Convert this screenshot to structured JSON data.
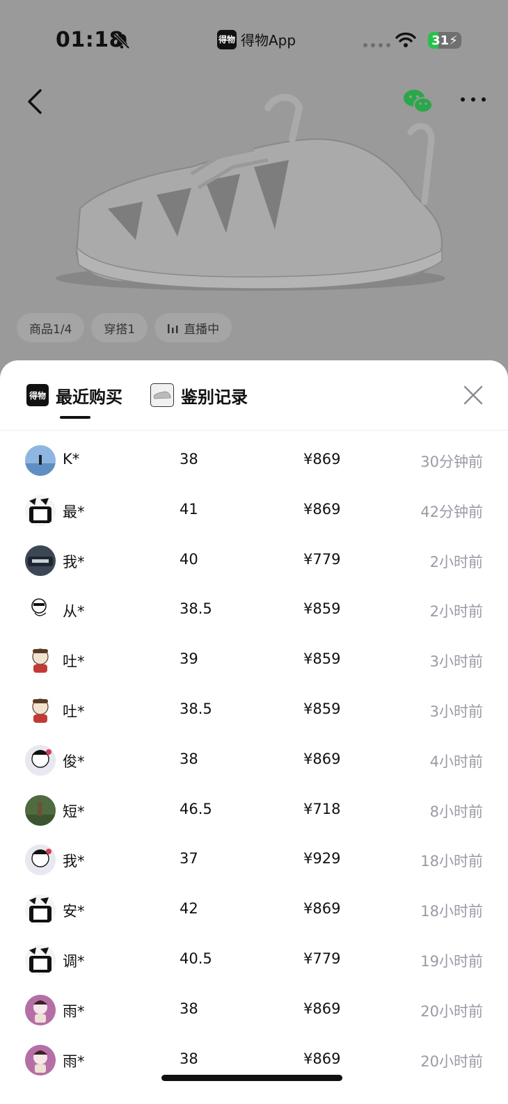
{
  "status_bar": {
    "time": "01:18",
    "app_name": "得物App",
    "app_logo_text": "得物",
    "battery": "31",
    "battery_level": 0.31
  },
  "product_chips": [
    "商品1/4",
    "穿搭1",
    "直播中"
  ],
  "sheet": {
    "tabs": [
      {
        "label": "最近购买",
        "logo_text": "得物",
        "active": true
      },
      {
        "label": "鉴别记录",
        "active": false
      }
    ]
  },
  "purchases": [
    {
      "user": "K*",
      "size": "38",
      "price": "¥869",
      "time": "30分钟前",
      "avatar": "beach-photo-avatar"
    },
    {
      "user": "最*",
      "size": "41",
      "price": "¥869",
      "time": "42分钟前",
      "avatar": "default-avatar"
    },
    {
      "user": "我*",
      "size": "40",
      "price": "¥779",
      "time": "2小时前",
      "avatar": "car-photo-avatar"
    },
    {
      "user": "从*",
      "size": "38.5",
      "price": "¥859",
      "time": "2小时前",
      "avatar": "meme-avatar"
    },
    {
      "user": "吐*",
      "size": "39",
      "price": "¥859",
      "time": "3小时前",
      "avatar": "cartoon-dog-avatar"
    },
    {
      "user": "吐*",
      "size": "38.5",
      "price": "¥859",
      "time": "3小时前",
      "avatar": "cartoon-dog-avatar"
    },
    {
      "user": "俊*",
      "size": "38",
      "price": "¥869",
      "time": "4小时前",
      "avatar": "cartoon-avatar"
    },
    {
      "user": "短*",
      "size": "46.5",
      "price": "¥718",
      "time": "8小时前",
      "avatar": "field-photo-avatar"
    },
    {
      "user": "我*",
      "size": "37",
      "price": "¥929",
      "time": "18小时前",
      "avatar": "cartoon-avatar"
    },
    {
      "user": "安*",
      "size": "42",
      "price": "¥869",
      "time": "18小时前",
      "avatar": "default-avatar"
    },
    {
      "user": "调*",
      "size": "40.5",
      "price": "¥779",
      "time": "19小时前",
      "avatar": "default-avatar"
    },
    {
      "user": "雨*",
      "size": "38",
      "price": "¥869",
      "time": "20小时前",
      "avatar": "pink-cartoon-avatar"
    },
    {
      "user": "雨*",
      "size": "38",
      "price": "¥869",
      "time": "20小时前",
      "avatar": "pink-cartoon-avatar"
    }
  ],
  "colors": {
    "overlay_gray": "#9a9a9a",
    "time_gray": "#9a9aa6",
    "battery_green": "#27c24c",
    "wechat_green": "#2aa748"
  }
}
